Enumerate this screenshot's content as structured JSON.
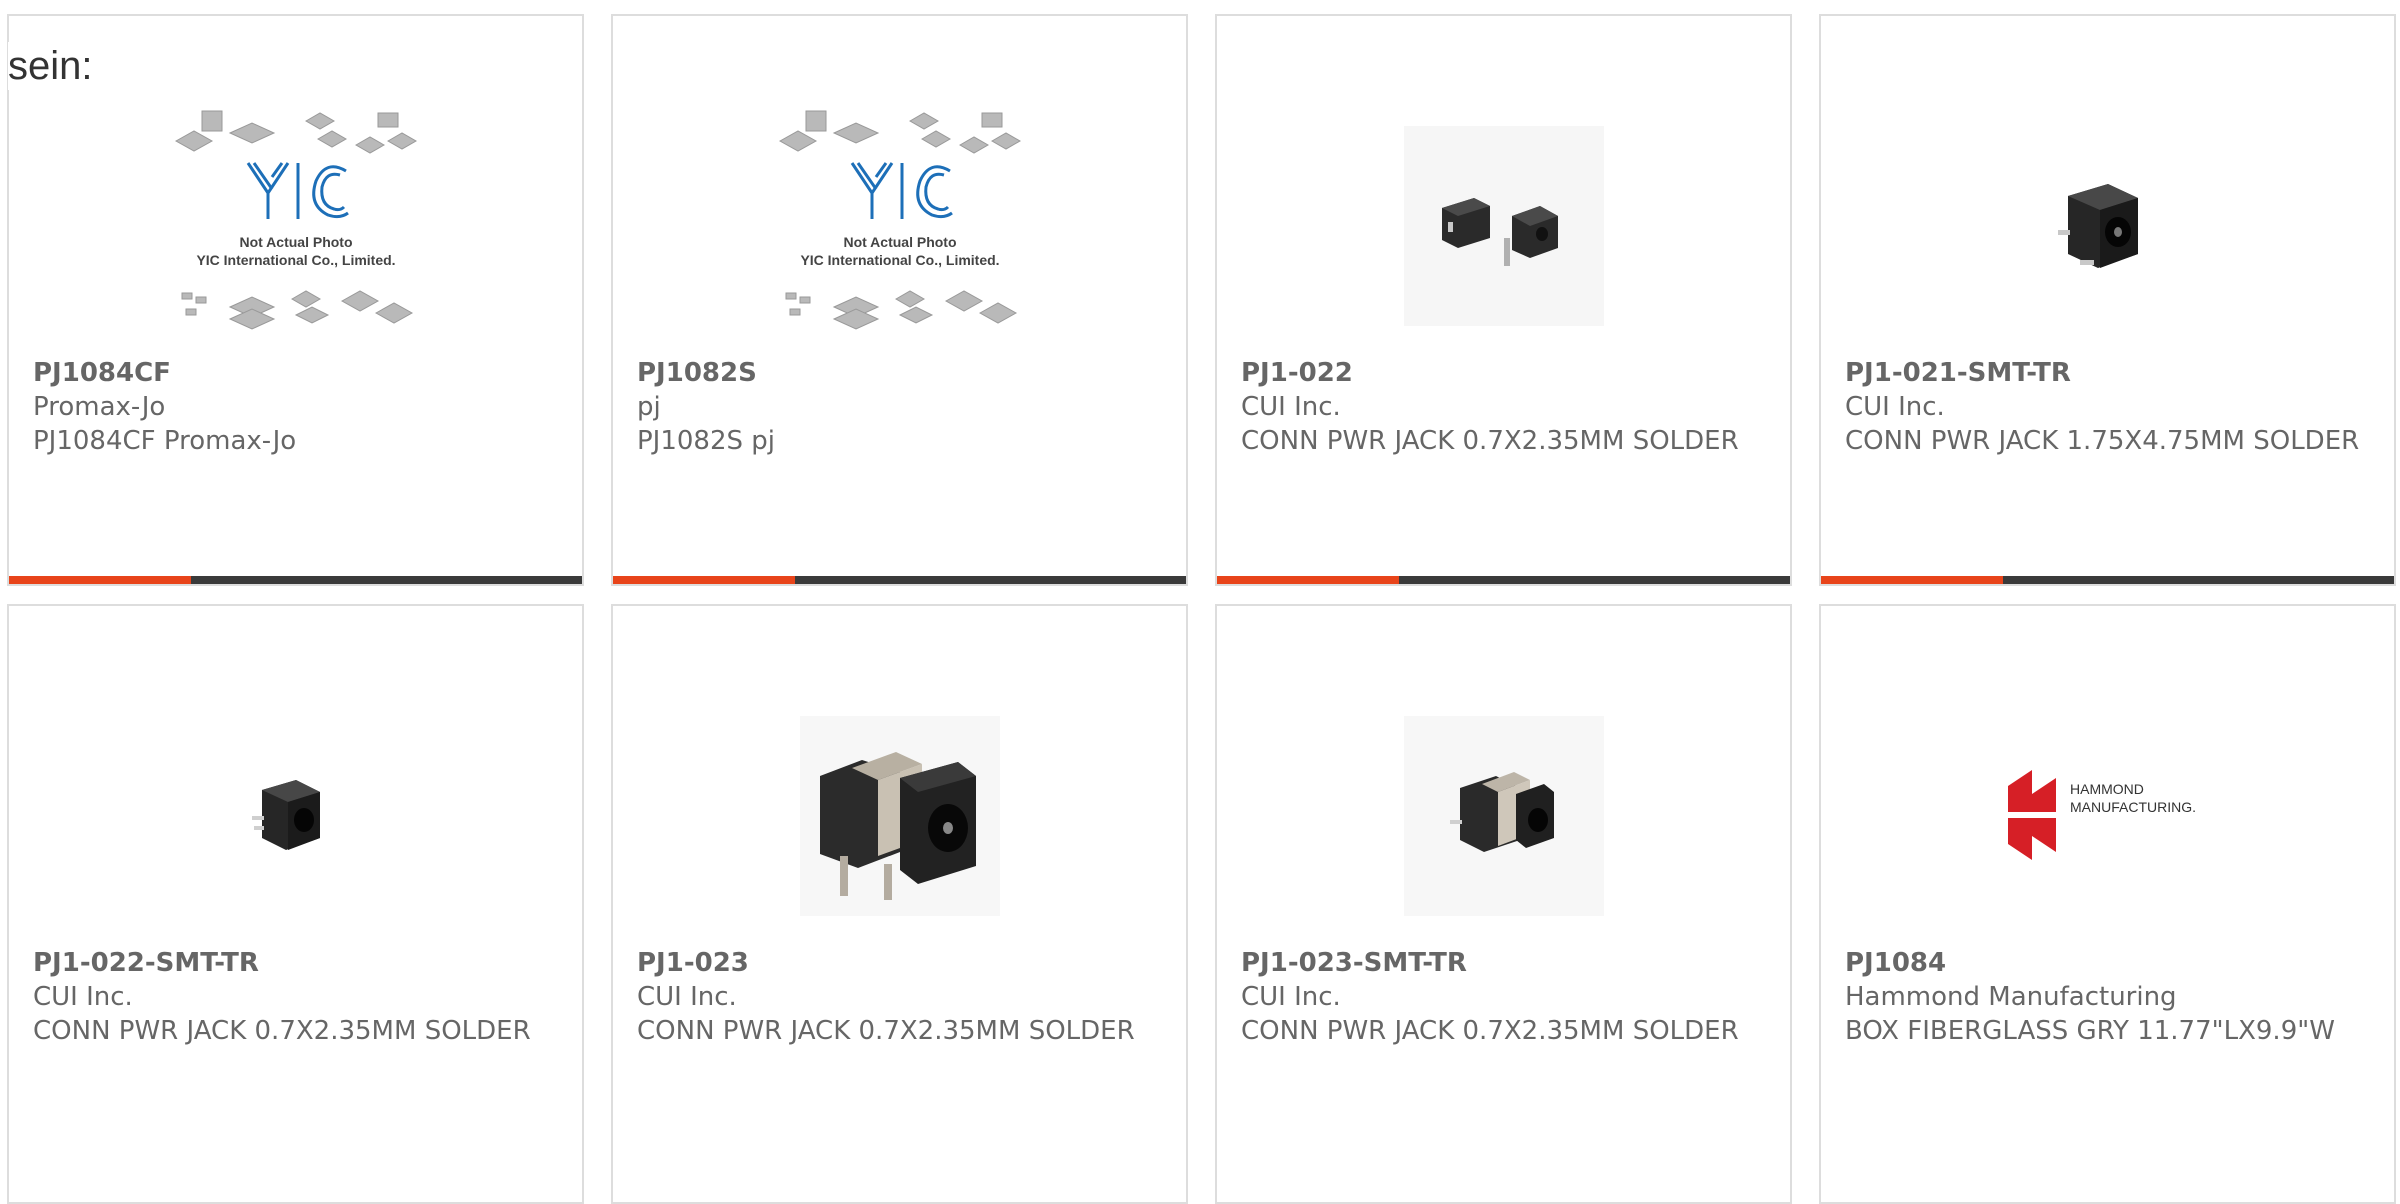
{
  "intro_text": "sein:",
  "colors": {
    "accent": "#e8441a",
    "bar": "#3a3a3a",
    "border": "#dddddd",
    "text": "#666666",
    "yic_blue": "#1d6fb8",
    "hammond_red": "#d61f26"
  },
  "products": [
    {
      "part": "PJ1084CF",
      "manufacturer": "Promax-Jo",
      "description": "PJ1084CF Promax-Jo",
      "image": "yic-placeholder",
      "placeholder_line1": "Not Actual Photo",
      "placeholder_line2": "YIC International Co., Limited."
    },
    {
      "part": "PJ1082S",
      "manufacturer": "pj",
      "description": "PJ1082S pj",
      "image": "yic-placeholder",
      "placeholder_line1": "Not Actual Photo",
      "placeholder_line2": "YIC International Co., Limited."
    },
    {
      "part": "PJ1-022",
      "manufacturer": "CUI Inc.",
      "description": "CONN PWR JACK 0.7X2.35MM SOLDER",
      "image": "dc-jack-pair"
    },
    {
      "part": "PJ1-021-SMT-TR",
      "manufacturer": "CUI Inc.",
      "description": "CONN PWR JACK 1.75X4.75MM SOLDER",
      "image": "dc-jack-smt"
    },
    {
      "part": "PJ1-022-SMT-TR",
      "manufacturer": "CUI Inc.",
      "description": "CONN PWR JACK 0.7X2.35MM SOLDER",
      "image": "dc-jack-small"
    },
    {
      "part": "PJ1-023",
      "manufacturer": "CUI Inc.",
      "description": "CONN PWR JACK 0.7X2.35MM SOLDER",
      "image": "dc-jack-large"
    },
    {
      "part": "PJ1-023-SMT-TR",
      "manufacturer": "CUI Inc.",
      "description": "CONN PWR JACK 0.7X2.35MM SOLDER",
      "image": "dc-jack-metal"
    },
    {
      "part": "PJ1084",
      "manufacturer": "Hammond Manufacturing",
      "description": "BOX FIBERGLASS GRY 11.77\"LX9.9\"W",
      "image": "hammond-logo",
      "logo_line1": "HAMMOND",
      "logo_line2": "MANUFACTURING."
    }
  ]
}
